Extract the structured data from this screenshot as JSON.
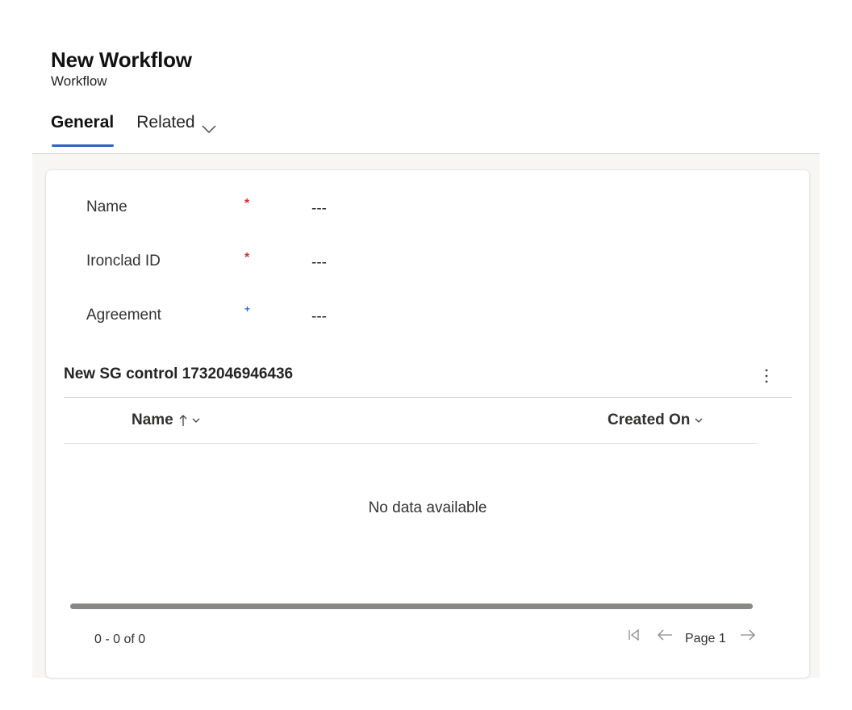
{
  "header": {
    "title": "New Workflow",
    "subtitle": "Workflow"
  },
  "tabs": [
    {
      "label": "General",
      "active": true
    },
    {
      "label": "Related",
      "active": false,
      "has_dropdown": true
    }
  ],
  "form": {
    "fields": [
      {
        "label": "Name",
        "required_marker": "*",
        "required_type": "required",
        "value": "---"
      },
      {
        "label": "Ironclad ID",
        "required_marker": "*",
        "required_type": "required",
        "value": "---"
      },
      {
        "label": "Agreement",
        "required_marker": "+",
        "required_type": "recommended",
        "value": "---"
      }
    ]
  },
  "subgrid": {
    "title": "New SG control 1732046946436",
    "columns": [
      {
        "label": "Name",
        "sort": "ascending"
      },
      {
        "label": "Created On",
        "sort": "none"
      }
    ],
    "empty_message": "No data available",
    "pager": {
      "count_text": "0 - 0 of 0",
      "page_label": "Page 1"
    }
  },
  "colors": {
    "accent": "#2a63c7",
    "required": "#d13438",
    "recommended": "#2266e3"
  },
  "icons": {
    "related_dropdown": "chevron-down-icon",
    "more": "more-vertical-icon",
    "sort_asc": "arrow-up-icon",
    "first_page": "first-page-icon",
    "prev_page": "arrow-left-icon",
    "next_page": "arrow-right-icon"
  }
}
